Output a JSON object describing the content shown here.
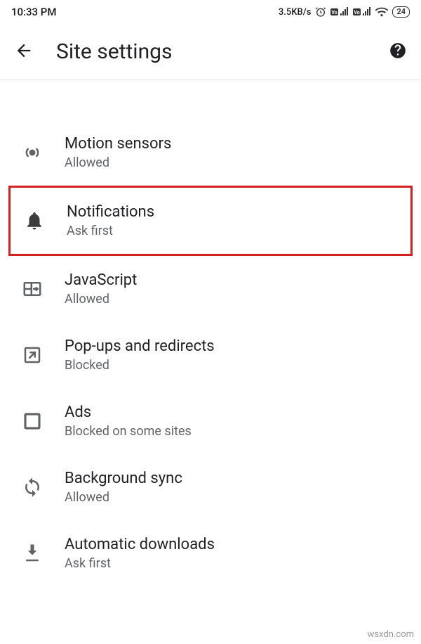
{
  "status": {
    "time": "10:33 PM",
    "speed": "3.5KB/s",
    "battery": "24"
  },
  "header": {
    "title": "Site settings"
  },
  "partial": {
    "sub": "Ask first"
  },
  "items": [
    {
      "label": "Motion sensors",
      "sub": "Allowed",
      "icon": "motion-icon",
      "highlighted": false
    },
    {
      "label": "Notifications",
      "sub": "Ask first",
      "icon": "bell-icon",
      "highlighted": true
    },
    {
      "label": "JavaScript",
      "sub": "Allowed",
      "icon": "javascript-icon",
      "highlighted": false
    },
    {
      "label": "Pop-ups and redirects",
      "sub": "Blocked",
      "icon": "popup-icon",
      "highlighted": false
    },
    {
      "label": "Ads",
      "sub": "Blocked on some sites",
      "icon": "ads-icon",
      "highlighted": false
    },
    {
      "label": "Background sync",
      "sub": "Allowed",
      "icon": "sync-icon",
      "highlighted": false
    },
    {
      "label": "Automatic downloads",
      "sub": "Ask first",
      "icon": "download-icon",
      "highlighted": false
    }
  ],
  "watermark": "wsxdn.com"
}
